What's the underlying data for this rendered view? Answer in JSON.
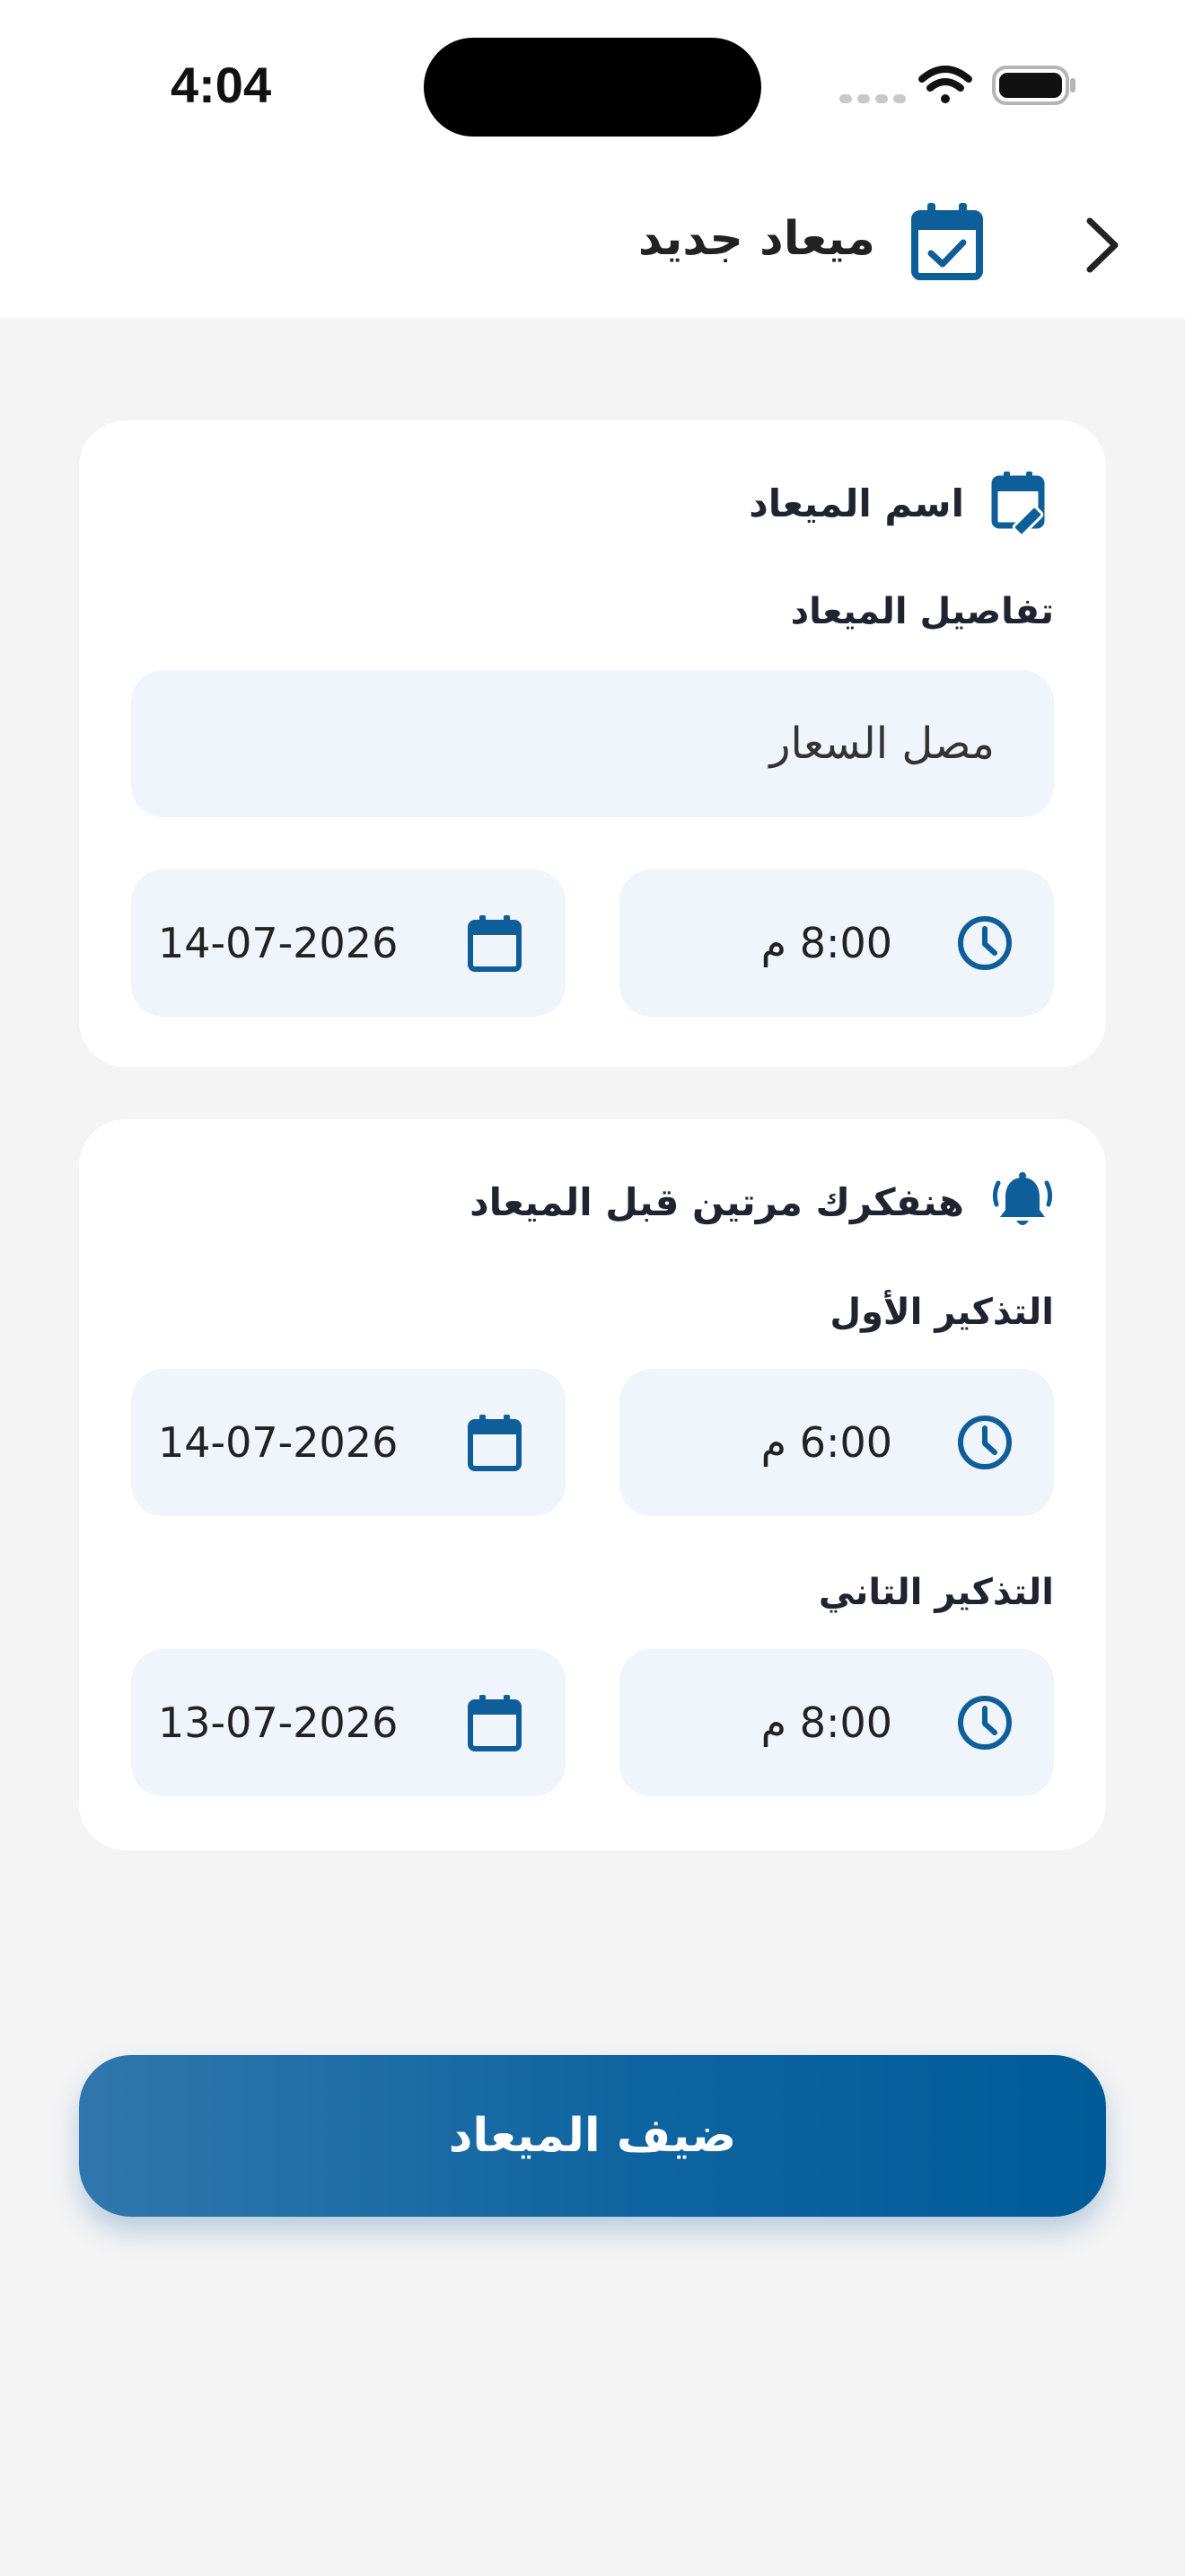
{
  "status_bar": {
    "time": "4:04"
  },
  "header": {
    "title": "ميعاد جديد",
    "back_icon": "chevron-right-icon",
    "title_icon": "calendar-check-icon"
  },
  "appointment_card": {
    "section_title": "اسم الميعاد",
    "section_icon": "calendar-edit-icon",
    "details_label": "تفاصيل الميعاد",
    "details_value": "مصل السعار",
    "date_value": "14-07-2026",
    "time_value": "8:00 م"
  },
  "reminders_card": {
    "section_title": "هنفكرك مرتين قبل الميعاد",
    "section_icon": "bell-ringing-icon",
    "first_label": "التذكير الأول",
    "first_date": "14-07-2026",
    "first_time": "6:00 م",
    "second_label": "التذكير التاني",
    "second_date": "13-07-2026",
    "second_time": "8:00 م"
  },
  "submit": {
    "label": "ضيف الميعاد"
  },
  "colors": {
    "accent": "#005b98",
    "field_bg": "#eff5fa",
    "page_bg": "#f4f4f5"
  }
}
